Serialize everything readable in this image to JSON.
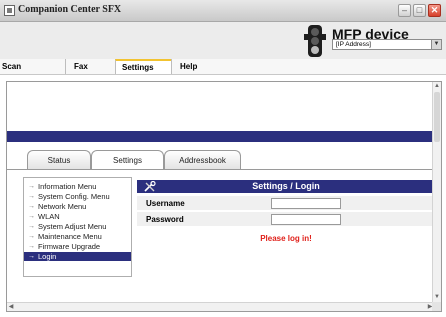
{
  "window": {
    "title": "Companion Center SFX",
    "controls": {
      "minimize": "–",
      "maximize": "□",
      "close": "✕"
    }
  },
  "header": {
    "device_title": "MFP device",
    "ip_select_value": "[IP Address]"
  },
  "menu": {
    "items": [
      {
        "label": "Scan",
        "active": false
      },
      {
        "label": "Fax",
        "active": false
      },
      {
        "label": "Settings",
        "active": true
      },
      {
        "label": "Help",
        "active": false
      }
    ]
  },
  "tabs": [
    {
      "label": "Status",
      "active": false
    },
    {
      "label": "Settings",
      "active": true
    },
    {
      "label": "Addressbook",
      "active": false
    }
  ],
  "nav": {
    "items": [
      {
        "label": "Information Menu",
        "active": false
      },
      {
        "label": "System Config. Menu",
        "active": false
      },
      {
        "label": "Network Menu",
        "active": false
      },
      {
        "label": "WLAN",
        "active": false
      },
      {
        "label": "System Adjust Menu",
        "active": false
      },
      {
        "label": "Maintenance Menu",
        "active": false
      },
      {
        "label": "Firmware Upgrade",
        "active": false
      },
      {
        "label": "Login",
        "active": true
      }
    ]
  },
  "panel": {
    "title": "Settings / Login",
    "icon": "tools-icon",
    "username_label": "Username",
    "password_label": "Password",
    "username_value": "",
    "password_value": "",
    "message": "Please log in!"
  },
  "colors": {
    "accent": "#2b2f7e",
    "tab_highlight": "#f2c330",
    "error": "#e0201a"
  }
}
